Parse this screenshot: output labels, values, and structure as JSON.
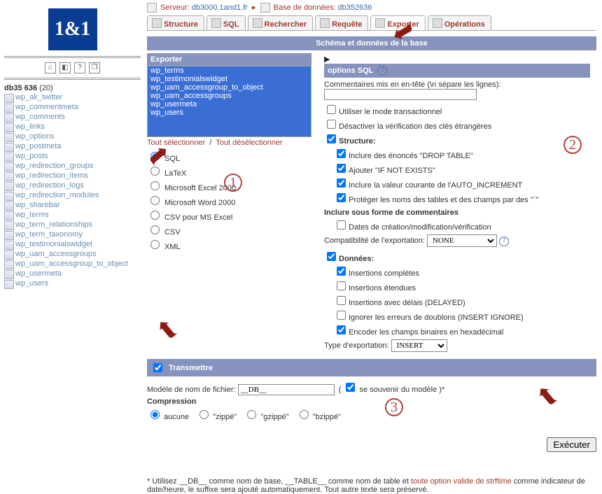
{
  "logo": "1&1",
  "db_name": "db35 636",
  "db_count": "(20)",
  "sidebar": {
    "tables": [
      "wp_ak_twitter",
      "wp_commentmeta",
      "wp_comments",
      "wp_links",
      "wp_options",
      "wp_postmeta",
      "wp_posts",
      "wp_redirection_groups",
      "wp_redirection_items",
      "wp_redirection_logs",
      "wp_redirection_modules",
      "wp_sharebar",
      "wp_terms",
      "wp_term_relationships",
      "wp_term_taxonomy",
      "wp_testimonialswidget",
      "wp_uam_accessgroups",
      "wp_uam_accessgroup_to_object",
      "wp_usermeta",
      "wp_users"
    ]
  },
  "crumb": {
    "server_lbl": "Serveur:",
    "server_val": "db3000.1and1.fr",
    "db_lbl": "Base de données:",
    "db_val": "db352636"
  },
  "tabs": [
    "Structure",
    "SQL",
    "Rechercher",
    "Requête",
    "Exporter",
    "Opérations"
  ],
  "banner": "Schéma et données de la base",
  "export": {
    "hdr": "Exporter",
    "selected_tables": [
      "wp_terms",
      "wp_testimonialswidget",
      "wp_uam_accessgroup_to_object",
      "wp_uam_accessgroups",
      "wp_usermeta",
      "wp_users"
    ],
    "select_all": "Tout sélectionner",
    "deselect_all": "Tout désélectionner",
    "formats": [
      "SQL",
      "LaTeX",
      "Microsoft Excel 2000",
      "Microsoft Word 2000",
      "CSV pour MS Excel",
      "CSV",
      "XML"
    ]
  },
  "sqlopts": {
    "hdr": "options SQL",
    "comments_lbl": "Commentaires mis en en-tête (\\n sépare les lignes):",
    "transactional": "Utiliser le mode transactionnel",
    "disable_fk": "Désactiver la vérification des clés étrangères",
    "structure": "Structure:",
    "s1": "Inclure des énoncés \"DROP TABLE\"",
    "s2": "Ajouter \"IF NOT EXISTS\"",
    "s3": "Inclure la valeur courante de l'AUTO_INCREMENT",
    "s4": "Protéger les noms des tables et des champs par des \"`\"",
    "comments_form": "Inclure sous forme de commentaires",
    "dates": "Dates de création/modification/vérification",
    "compat": "Compatibilité de l'exportation:",
    "compat_val": "NONE",
    "data": "Données:",
    "d1": "Insertions complètes",
    "d2": "Insertions étendues",
    "d3": "Insertions avec délais (DELAYED)",
    "d4": "Ignorer les erreurs de doublons (INSERT IGNORE)",
    "d5": "Encoder les champs binaires en hexadécimal",
    "type_lbl": "Type d'exportation:",
    "type_val": "INSERT"
  },
  "transmit": {
    "hdr": "Transmettre",
    "model_lbl": "Modèle de nom de fichier:",
    "model_val": "__DB__",
    "remember": "se souvenir du modèle )*",
    "compress": "Compression",
    "c": [
      "aucune",
      "\"zippé\"",
      "\"gzippé\"",
      "\"bzippé\""
    ],
    "exec": "Exécuter"
  },
  "footer": {
    "pre": "* Utilisez __DB__ comme nom de base, __TABLE__ comme nom de table et ",
    "red": "toute option valide de strftime",
    "post": " comme indicateur de date/heure, le suffixe sera ajouté automatiquement. Tout autre texte sera préservé."
  }
}
